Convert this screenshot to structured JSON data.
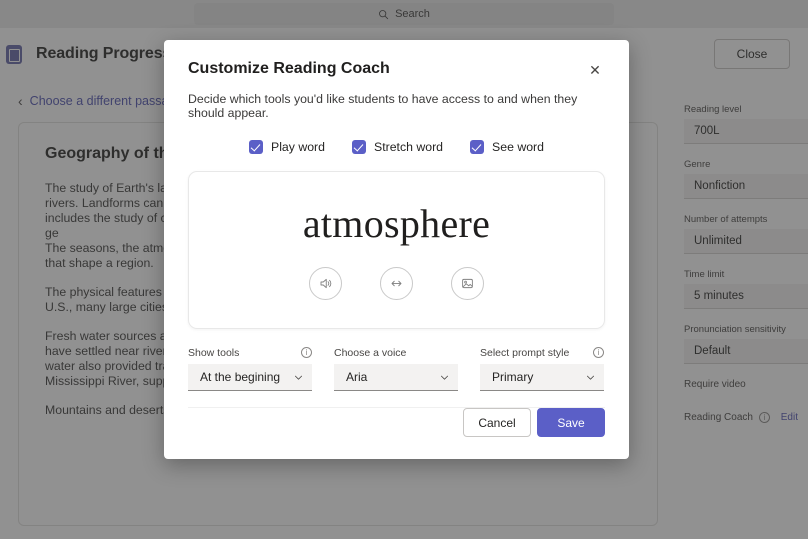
{
  "topbar": {
    "search_placeholder": "Search",
    "search_icon": "search-icon"
  },
  "header": {
    "app_icon": "reading-progress-app-icon",
    "title": "Reading Progress",
    "close_label": "Close"
  },
  "content": {
    "back_link": "Choose a different passage",
    "back_icon": "chevron-left-icon",
    "passage": {
      "title": "Geography of the Earth",
      "paragraphs": [
        "The study of Earth's landforms and features includes mountains, valleys, plains, deserts, glaciers, lakes, or rivers. Landforms can be the result of wind, water, or ice erosion. The physical geography of Earth also includes the study of climate, weather patterns, and vegetation.\nge\nThe seasons, the atmosphere, and the distance from the equator are all part of the combination of factors that shape a region.",
        "The physical features of a region often determine how people live there, including settlement areas. In the U.S., many large cities grew along coastlines and rivers.",
        "Fresh water sources also influenced where people chose to build communities. Throughout history, people have settled near rivers and lakes because water was needed for survival. There was an added bonus, as water also provided transportation and food. Some of the most popular water sources, such as the Mississippi River, supported entire regional economies.",
        "Mountains and deserts have shaped settlement patterns too, each presenting challenges of their own."
      ]
    }
  },
  "settings_rail": {
    "groups": [
      {
        "label": "Reading level",
        "value": "700L"
      },
      {
        "label": "Genre",
        "value": "Nonfiction"
      },
      {
        "label": "Number of attempts",
        "value": "Unlimited"
      },
      {
        "label": "Time limit",
        "value": "5 minutes"
      },
      {
        "label": "Pronunciation sensitivity",
        "value": "Default"
      }
    ],
    "require_video_label": "Require video",
    "reading_coach_label": "Reading Coach",
    "reading_coach_info_icon": "info-icon",
    "edit_label": "Edit"
  },
  "modal": {
    "title": "Customize Reading Coach",
    "close_icon": "close-icon",
    "subtitle": "Decide which tools you'd like students to have access to and when they should appear.",
    "checkboxes": [
      {
        "label": "Play word",
        "checked": true
      },
      {
        "label": "Stretch word",
        "checked": true
      },
      {
        "label": "See word",
        "checked": true
      }
    ],
    "preview": {
      "word": "atmosphere",
      "tools": [
        {
          "icon": "speaker-icon",
          "name": "play-word-tool"
        },
        {
          "icon": "stretch-arrows-icon",
          "name": "stretch-word-tool"
        },
        {
          "icon": "image-icon",
          "name": "see-word-tool"
        }
      ]
    },
    "selects": [
      {
        "label": "Show tools",
        "value": "At the begining",
        "info": true
      },
      {
        "label": "Choose a voice",
        "value": "Aria",
        "info": false
      },
      {
        "label": "Select prompt style",
        "value": "Primary",
        "info": true
      }
    ],
    "cancel_label": "Cancel",
    "save_label": "Save"
  },
  "colors": {
    "accent": "#5b5fc7",
    "link": "#4f52b2",
    "scrim": "#373737"
  }
}
